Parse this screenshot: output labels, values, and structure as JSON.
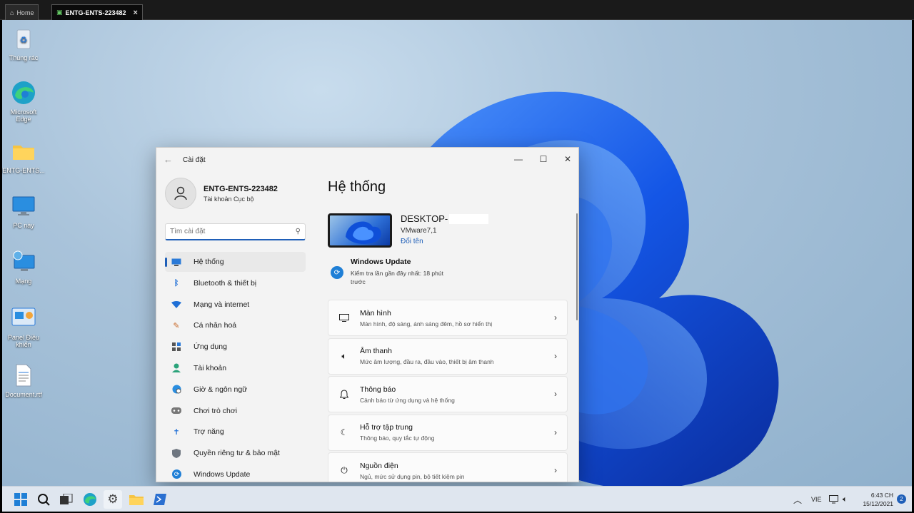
{
  "host": {
    "tabs": [
      {
        "label": "Home"
      },
      {
        "label": "ENTG-ENTS-223482"
      }
    ]
  },
  "desktop": {
    "icons": [
      {
        "label": "Thùng rác"
      },
      {
        "label": "Microsoft Edge"
      },
      {
        "label": "ENTG-ENTS..."
      },
      {
        "label": "PC này"
      },
      {
        "label": "Mạng"
      },
      {
        "label": "Panel Điều khiển"
      },
      {
        "label": "Document.rtf"
      }
    ]
  },
  "settings": {
    "title": "Cài đặt",
    "profile": {
      "name": "ENTG-ENTS-223482",
      "account": "Tài khoản Cục bộ"
    },
    "search": {
      "placeholder": "Tìm cài đặt"
    },
    "nav": [
      {
        "label": "Hệ thống",
        "icon": "monitor-icon"
      },
      {
        "label": "Bluetooth & thiết bị",
        "icon": "bluetooth-icon"
      },
      {
        "label": "Mạng và internet",
        "icon": "wifi-icon"
      },
      {
        "label": "Cá nhân hoá",
        "icon": "brush-icon"
      },
      {
        "label": "Ứng dụng",
        "icon": "apps-icon"
      },
      {
        "label": "Tài khoản",
        "icon": "person-icon"
      },
      {
        "label": "Giờ & ngôn ngữ",
        "icon": "globe-clock-icon"
      },
      {
        "label": "Chơi trò chơi",
        "icon": "gamepad-icon"
      },
      {
        "label": "Trợ năng",
        "icon": "accessibility-icon"
      },
      {
        "label": "Quyền riêng tư & bảo mật",
        "icon": "shield-icon"
      },
      {
        "label": "Windows Update",
        "icon": "update-icon"
      }
    ],
    "page_title": "Hệ thống",
    "device": {
      "name": "DESKTOP-",
      "model": "VMware7,1",
      "rename": "Đổi tên"
    },
    "update": {
      "title": "Windows Update",
      "subtitle": "Kiểm tra lần gần đây nhất: 18 phút trước"
    },
    "cards": [
      {
        "title": "Màn hình",
        "subtitle": "Màn hình, độ sáng, ánh sáng đêm, hồ sơ hiển thị",
        "icon": "display-icon"
      },
      {
        "title": "Âm thanh",
        "subtitle": "Mức âm lượng, đầu ra, đầu vào, thiết bị âm thanh",
        "icon": "speaker-icon"
      },
      {
        "title": "Thông báo",
        "subtitle": "Cảnh báo từ ứng dụng và hệ thống",
        "icon": "bell-icon"
      },
      {
        "title": "Hỗ trợ tập trung",
        "subtitle": "Thông báo, quy tắc tự động",
        "icon": "moon-icon"
      },
      {
        "title": "Nguồn điện",
        "subtitle": "Ngủ, mức sử dụng pin, bộ tiết kiệm pin",
        "icon": "power-icon"
      }
    ]
  },
  "taskbar": {
    "lang": "VIE",
    "time": "6:43 CH",
    "date": "15/12/2021",
    "notifications": "2"
  }
}
